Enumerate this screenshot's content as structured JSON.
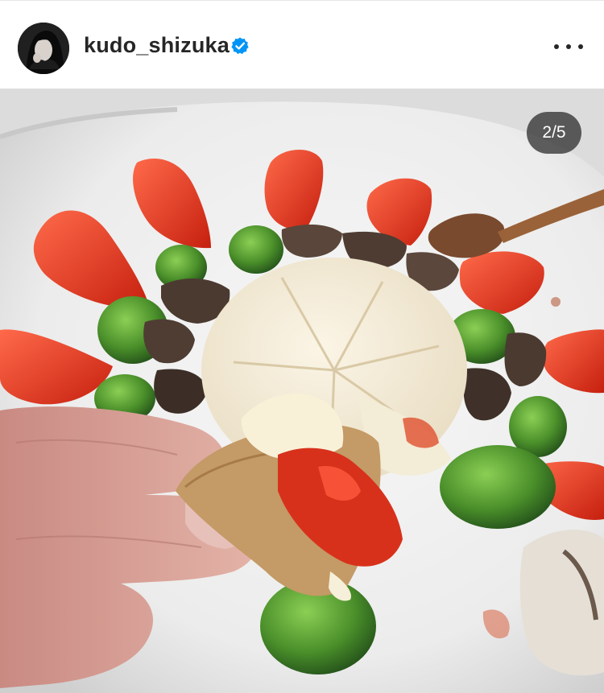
{
  "post": {
    "username": "kudo_shizuka",
    "verified": true,
    "counter": "2/5"
  },
  "icons": {
    "verified": "verified-badge-icon",
    "more": "more-options-icon"
  },
  "colors": {
    "verified_blue": "#0095f6",
    "text": "#262626",
    "counter_bg": "#262626"
  }
}
